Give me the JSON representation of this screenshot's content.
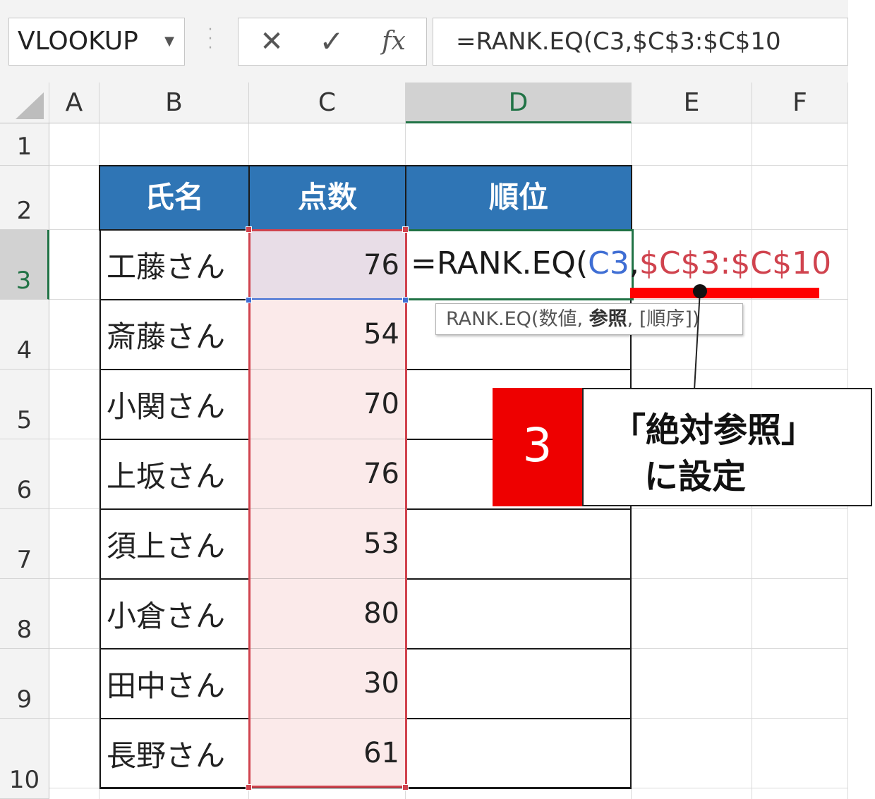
{
  "formula_bar": {
    "name_box": "VLOOKUP",
    "cancel_icon": "✕",
    "confirm_icon": "✓",
    "fx_label": "fx",
    "formula": "=RANK.EQ(C3,$C$3:$C$10"
  },
  "columns": [
    "A",
    "B",
    "C",
    "D",
    "E",
    "F"
  ],
  "rows": [
    "1",
    "2",
    "3",
    "4",
    "5",
    "6",
    "7",
    "8",
    "9",
    "10"
  ],
  "table": {
    "headers": [
      "氏名",
      "点数",
      "順位"
    ],
    "names": [
      "工藤さん",
      "斎藤さん",
      "小関さん",
      "上坂さん",
      "須上さん",
      "小倉さん",
      "田中さん",
      "長野さん"
    ],
    "scores": [
      "76",
      "54",
      "70",
      "76",
      "53",
      "80",
      "30",
      "61"
    ]
  },
  "edit": {
    "prefix": "=RANK.EQ(",
    "ref_blue": "C3",
    "comma": ",",
    "ref_red": "$C$3:$C$10"
  },
  "tooltip": {
    "fn": "RANK.EQ(",
    "arg1": "数値",
    "sep1": ", ",
    "arg2": "参照",
    "sep2": ", ",
    "arg3": "[順序])"
  },
  "annotation": {
    "step": "3",
    "line1": "「絶対参照」",
    "line2": "に設定"
  },
  "colors": {
    "header_blue": "#2f75b5",
    "range_red": "#d0434e",
    "ref_blue": "#3f6ed4",
    "accent_red": "#ee0000",
    "excel_green": "#217346"
  }
}
